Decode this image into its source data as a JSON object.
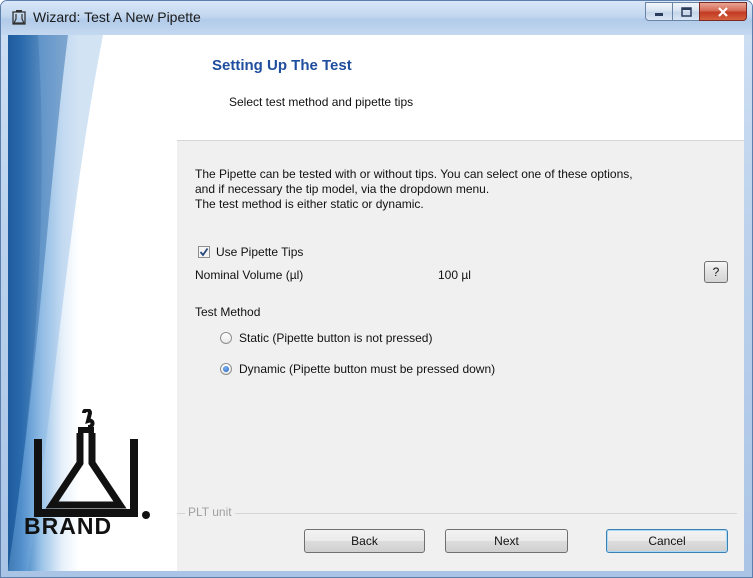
{
  "window": {
    "title": "Wizard: Test A New Pipette"
  },
  "header": {
    "title": "Setting Up The Test",
    "subtitle": "Select test method and pipette tips"
  },
  "description": {
    "line1": "The Pipette can be tested with or without tips. You can select one of these options,",
    "line2": "and if necessary the tip model, via the dropdown menu.",
    "line3": "The test method is either static or dynamic."
  },
  "tips": {
    "label": "Use Pipette Tips",
    "checked": true
  },
  "nominal": {
    "label": "Nominal Volume (µl)",
    "value": "100 µl",
    "help_label": "?"
  },
  "test_method": {
    "label": "Test Method",
    "options": [
      {
        "label": "Static (Pipette button is not pressed)",
        "selected": false
      },
      {
        "label": "Dynamic (Pipette button must be pressed down)",
        "selected": true
      }
    ]
  },
  "group": {
    "label": "PLT unit"
  },
  "buttons": {
    "back": "Back",
    "next": "Next",
    "cancel": "Cancel"
  },
  "branding": {
    "name": "BRAND"
  },
  "colors": {
    "heading": "#1f4e9e",
    "close_button": "#c23a22"
  }
}
